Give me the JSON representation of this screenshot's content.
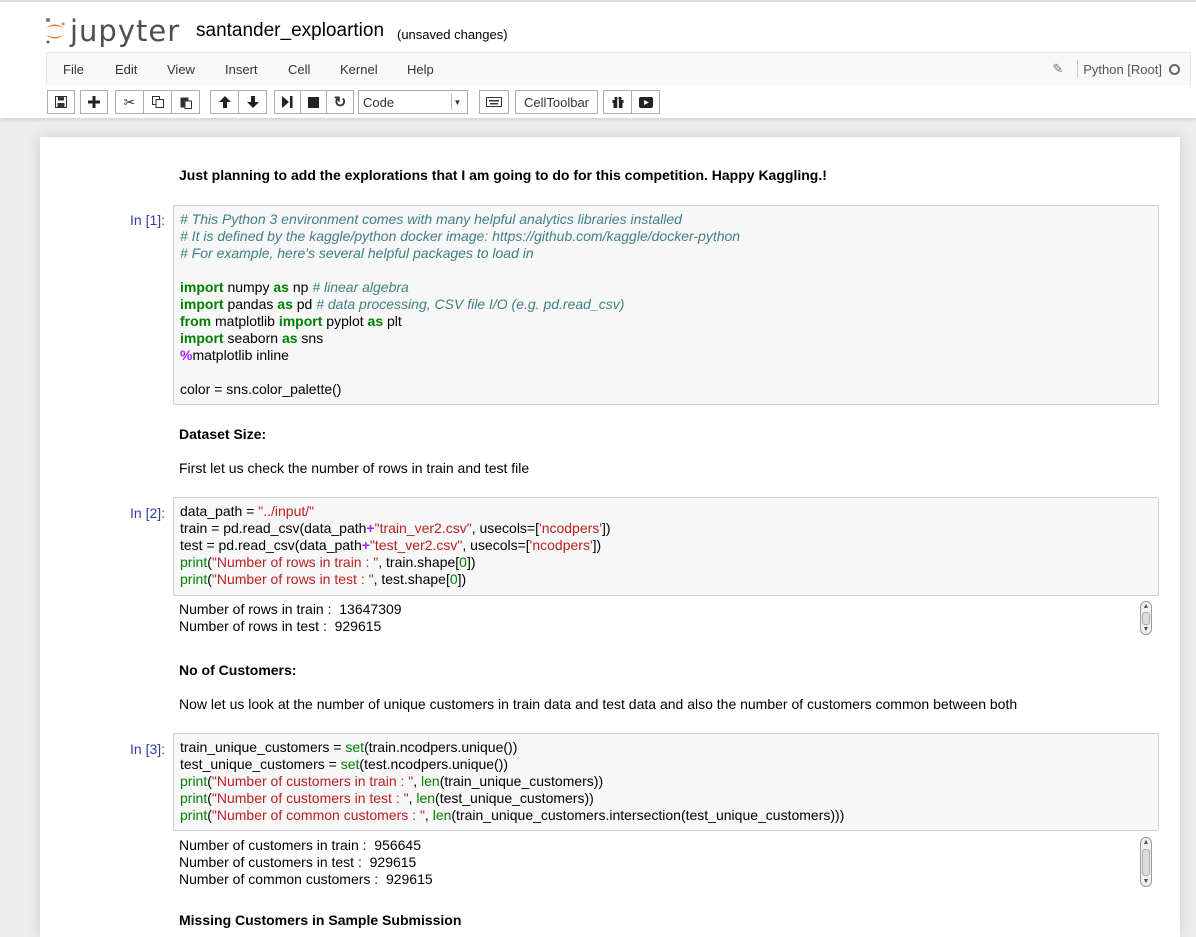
{
  "header": {
    "logo_text": "jupyter",
    "notebook_name": "santander_exploartion",
    "save_status": "(unsaved changes)",
    "brand_color": "#f37726"
  },
  "menu": {
    "items": [
      "File",
      "Edit",
      "View",
      "Insert",
      "Cell",
      "Kernel",
      "Help"
    ],
    "kernel_name": "Python [Root]",
    "edit_icon": "pencil-icon",
    "kernel_status_icon": "kernel-idle-circle-icon"
  },
  "toolbar": {
    "icons": [
      "save-icon",
      "add-cell-icon",
      "cut-icon",
      "copy-icon",
      "paste-icon",
      "move-up-icon",
      "move-down-icon",
      "run-icon",
      "stop-icon",
      "restart-icon",
      "keyboard-icon",
      "gift-icon",
      "presentation-icon"
    ],
    "cell_type": "Code",
    "celltoolbar_label": "CellToolbar"
  },
  "cells": {
    "md1": "Just planning to add the explorations that I am going to do for this competition. Happy Kaggling.!",
    "in1": {
      "prompt": "In [1]:",
      "lines": [
        [
          [
            "comment",
            "# This Python 3 environment comes with many helpful analytics libraries installed"
          ]
        ],
        [
          [
            "comment",
            "# It is defined by the kaggle/python docker image: https://github.com/kaggle/docker-python"
          ]
        ],
        [
          [
            "comment",
            "# For example, here's several helpful packages to load in"
          ]
        ],
        [],
        [
          [
            "kw",
            "import"
          ],
          [
            "",
            " numpy "
          ],
          [
            "kw",
            "as"
          ],
          [
            "",
            " np "
          ],
          [
            "comment",
            "# linear algebra"
          ]
        ],
        [
          [
            "kw",
            "import"
          ],
          [
            "",
            " pandas "
          ],
          [
            "kw",
            "as"
          ],
          [
            "",
            " pd "
          ],
          [
            "comment",
            "# data processing, CSV file I/O (e.g. pd.read_csv)"
          ]
        ],
        [
          [
            "kw",
            "from"
          ],
          [
            "",
            " matplotlib "
          ],
          [
            "kw",
            "import"
          ],
          [
            "",
            " pyplot "
          ],
          [
            "kw",
            "as"
          ],
          [
            "",
            " plt"
          ]
        ],
        [
          [
            "kw",
            "import"
          ],
          [
            "",
            " seaborn "
          ],
          [
            "kw",
            "as"
          ],
          [
            "",
            " sns"
          ]
        ],
        [
          [
            "op",
            "%"
          ],
          [
            "",
            "matplotlib inline"
          ]
        ],
        [],
        [
          [
            "",
            "color = sns.color_palette()"
          ]
        ]
      ]
    },
    "md2_heading": "Dataset Size:",
    "md2_text": "First let us check the number of rows in train and test file",
    "in2": {
      "prompt": "In [2]:",
      "lines": [
        [
          [
            "",
            "data_path = "
          ],
          [
            "str",
            "\"../input/\""
          ]
        ],
        [
          [
            "",
            "train = pd.read_csv(data_path"
          ],
          [
            "op",
            "+"
          ],
          [
            "str",
            "\"train_ver2.csv\""
          ],
          [
            "",
            ", usecols=["
          ],
          [
            "str",
            "'ncodpers'"
          ],
          [
            "",
            "])"
          ]
        ],
        [
          [
            "",
            "test = pd.read_csv(data_path"
          ],
          [
            "op",
            "+"
          ],
          [
            "str",
            "\"test_ver2.csv\""
          ],
          [
            "",
            ", usecols=["
          ],
          [
            "str",
            "'ncodpers'"
          ],
          [
            "",
            "])"
          ]
        ],
        [
          [
            "builtin",
            "print"
          ],
          [
            "",
            "("
          ],
          [
            "str",
            "\"Number of rows in train : \""
          ],
          [
            "",
            ", train.shape["
          ],
          [
            "builtin",
            "0"
          ],
          [
            "",
            "])"
          ]
        ],
        [
          [
            "builtin",
            "print"
          ],
          [
            "",
            "("
          ],
          [
            "str",
            "\"Number of rows in test : \""
          ],
          [
            "",
            ", test.shape["
          ],
          [
            "builtin",
            "0"
          ],
          [
            "",
            "])"
          ]
        ]
      ]
    },
    "out2": [
      "Number of rows in train :  13647309",
      "Number of rows in test :  929615"
    ],
    "md3_heading": "No of Customers:",
    "md3_text": "Now let us look at the number of unique customers in train data and test data and also the number of customers common between both",
    "in3": {
      "prompt": "In [3]:",
      "lines": [
        [
          [
            "",
            "train_unique_customers = "
          ],
          [
            "builtin",
            "set"
          ],
          [
            "",
            "(train.ncodpers.unique())"
          ]
        ],
        [
          [
            "",
            "test_unique_customers = "
          ],
          [
            "builtin",
            "set"
          ],
          [
            "",
            "(test.ncodpers.unique())"
          ]
        ],
        [
          [
            "builtin",
            "print"
          ],
          [
            "",
            "("
          ],
          [
            "str",
            "\"Number of customers in train : \""
          ],
          [
            "",
            ", "
          ],
          [
            "builtin",
            "len"
          ],
          [
            "",
            "(train_unique_customers))"
          ]
        ],
        [
          [
            "builtin",
            "print"
          ],
          [
            "",
            "("
          ],
          [
            "str",
            "\"Number of customers in test : \""
          ],
          [
            "",
            ", "
          ],
          [
            "builtin",
            "len"
          ],
          [
            "",
            "(test_unique_customers))"
          ]
        ],
        [
          [
            "builtin",
            "print"
          ],
          [
            "",
            "("
          ],
          [
            "str",
            "\"Number of common customers : \""
          ],
          [
            "",
            ", "
          ],
          [
            "builtin",
            "len"
          ],
          [
            "",
            "(train_unique_customers.intersection(test_unique_customers)))"
          ]
        ]
      ]
    },
    "out3": [
      "Number of customers in train :  956645",
      "Number of customers in test :  929615",
      "Number of common customers :  929615"
    ],
    "md4_heading": "Missing Customers in Sample Submission"
  }
}
